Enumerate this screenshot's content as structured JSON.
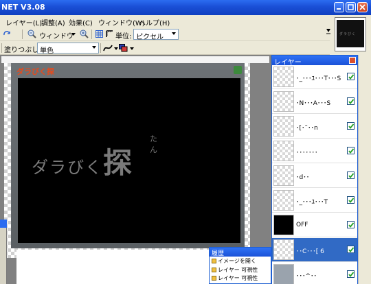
{
  "app": {
    "title": "NET V3.08"
  },
  "menu": [
    "レイヤー(L)",
    "調整(A)",
    "効果(C)",
    "ウィンドウ(W)",
    "ヘルプ(H)"
  ],
  "toolbar": {
    "window_label": "ウィンドウ",
    "unit_label": "単位:",
    "unit_value": "ピクセル",
    "fill_label": "塗りつぶし:",
    "fill_value": "単色"
  },
  "document": {
    "logo_small": "ダラびく探",
    "logo_kana": "ダラびく",
    "logo_kanji": "探",
    "logo_ruby": "たん"
  },
  "layers": {
    "title": "レイヤー",
    "items": [
      {
        "name": "･_･･･ﾕ･･･T･･･S",
        "thumb": "checker",
        "visible": true,
        "selected": false
      },
      {
        "name": "･N･･･A･･･S",
        "thumb": "checker",
        "visible": true,
        "selected": false
      },
      {
        "name": "･[･˜･･n",
        "thumb": "checker",
        "visible": true,
        "selected": false
      },
      {
        "name": "･･･････",
        "thumb": "checker",
        "visible": true,
        "selected": false
      },
      {
        "name": "･d･･",
        "thumb": "checker",
        "visible": true,
        "selected": false
      },
      {
        "name": "･_･･･ﾕ･･･T",
        "thumb": "checker",
        "visible": true,
        "selected": false
      },
      {
        "name": "OFF",
        "thumb": "black",
        "visible": true,
        "selected": false
      },
      {
        "name": "･･C･･･[ 6",
        "thumb": "checker",
        "visible": true,
        "selected": true
      },
      {
        "name": "･･･^･･",
        "thumb": "gray",
        "visible": true,
        "selected": false
      }
    ]
  },
  "history": {
    "title": "履歴",
    "items": [
      "イメージを開く",
      "レイヤー 可視性",
      "レイヤー 可視性"
    ]
  }
}
